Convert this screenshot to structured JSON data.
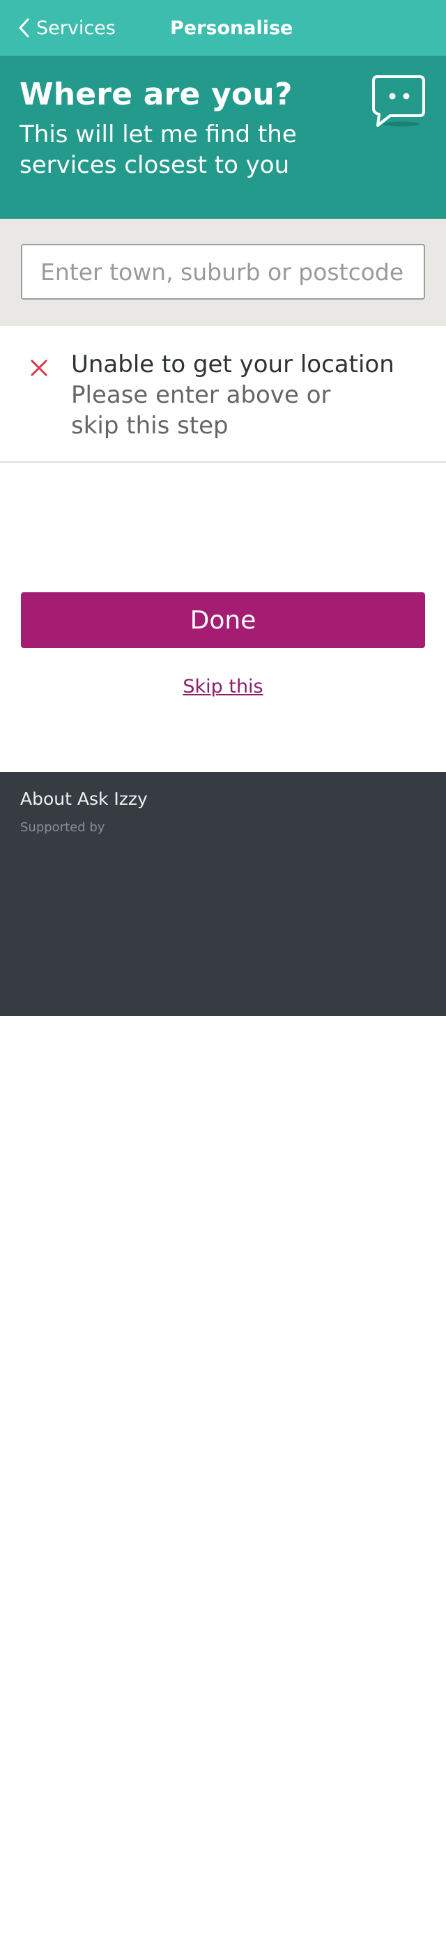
{
  "appbar": {
    "back_label": "Services",
    "title": "Personalise"
  },
  "header": {
    "title": "Where are you?",
    "subtitle": "This will let me find the services closest to you",
    "icon": "chat-bubble-face-icon"
  },
  "search": {
    "placeholder": "Enter town, suburb or postcode",
    "value": ""
  },
  "error": {
    "icon": "close-icon",
    "title": "Unable to get your location",
    "body": "Please enter above or skip this step"
  },
  "actions": {
    "done_label": "Done",
    "skip_label": "Skip this"
  },
  "footer": {
    "about_label": "About Ask Izzy",
    "supported_label": "Supported by"
  },
  "colors": {
    "appbar": "#3dbdad",
    "header": "#239a8c",
    "search_band": "#e9e8e4",
    "primary_button": "#a51c73",
    "link": "#8a2069",
    "error_icon": "#e0334c",
    "footer": "#373b42"
  }
}
